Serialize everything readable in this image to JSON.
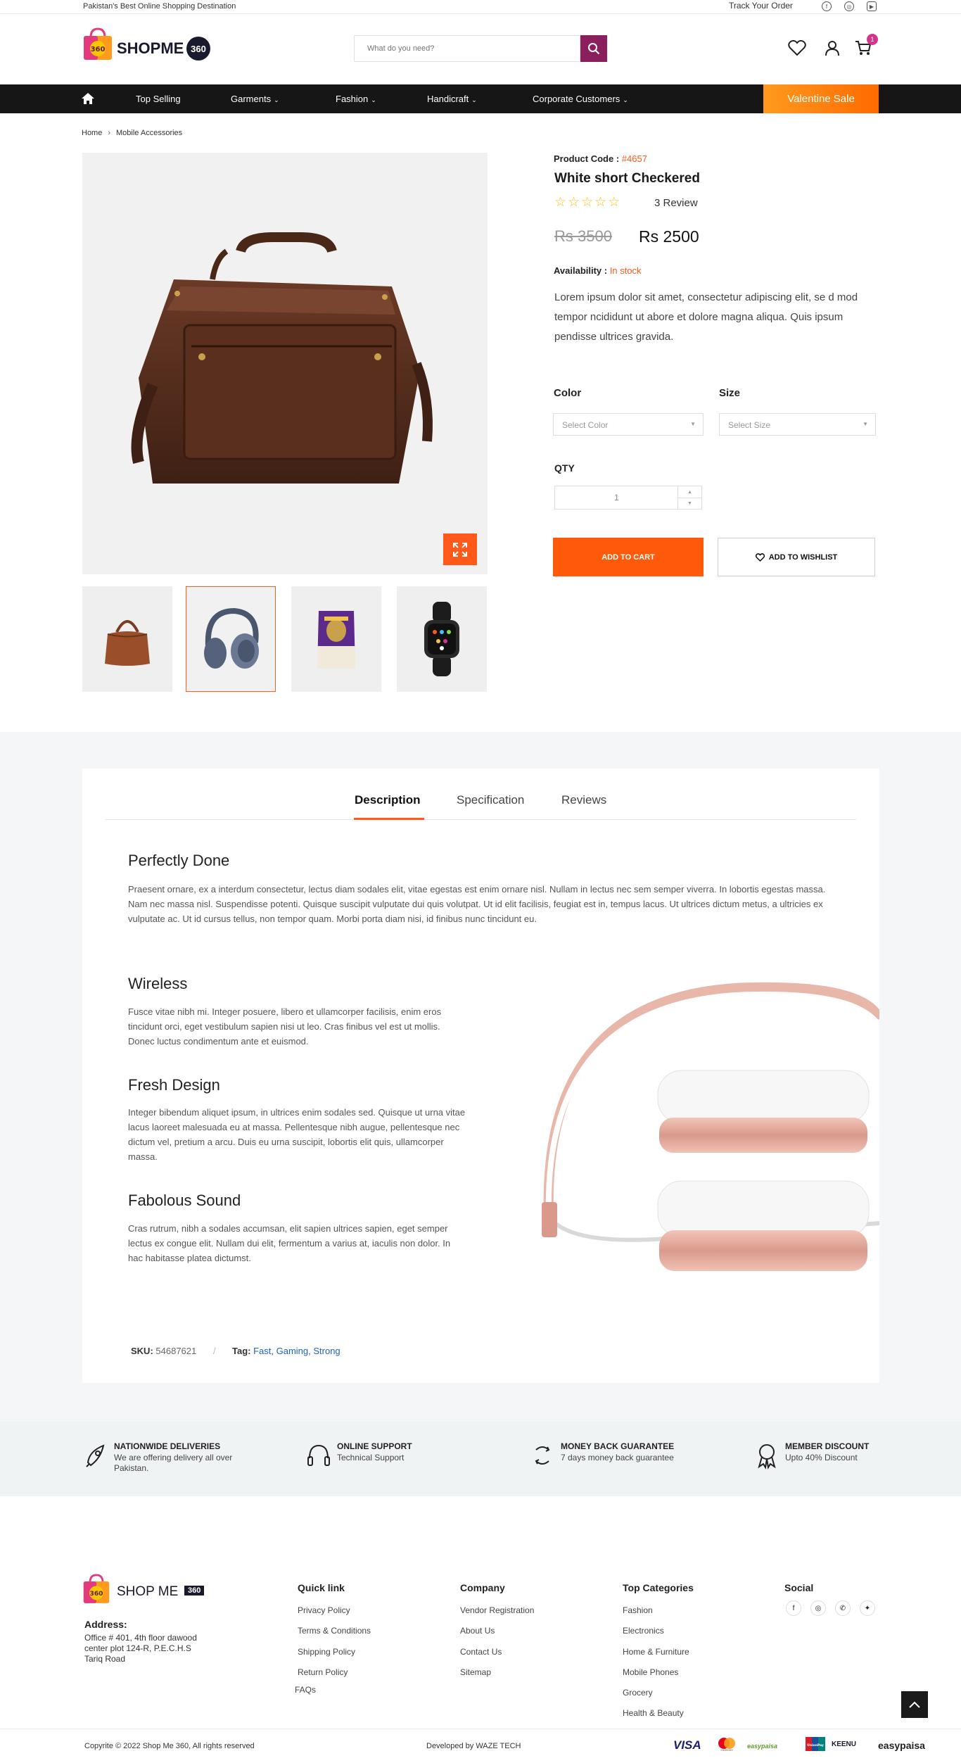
{
  "topbar": {
    "tagline": "Pakistan's Best Online Shopping Destination",
    "track_order": "Track Your Order",
    "social_icons": [
      "facebook-icon",
      "instagram-icon",
      "youtube-icon"
    ]
  },
  "header": {
    "logo_text": "SHOPME",
    "logo_badge": "360",
    "logo_bag_badge": "360",
    "search_placeholder": "What do you need?",
    "cart_count": "1",
    "brand_color": "#8b1e5c"
  },
  "nav": {
    "items": [
      {
        "label": "Top Selling"
      },
      {
        "label": "Garments"
      },
      {
        "label": "Fashion"
      },
      {
        "label": "Handicraft"
      },
      {
        "label": "Corporate Customers"
      }
    ],
    "sale_label": "Valentine Sale"
  },
  "breadcrumb": {
    "items": [
      "Home",
      "Mobile Accessories"
    ]
  },
  "product": {
    "code_label": "Product Code :",
    "code": "#4657",
    "title": "White short Checkered",
    "rating_stars": 0,
    "review_label": "3 Review",
    "old_price": "Rs 3500",
    "new_price": "Rs 2500",
    "availability_label": "Availability :",
    "availability": "In stock",
    "description": "Lorem ipsum dolor sit amet, consectetur adipiscing elit, se d mod tempor ncididunt ut abore et dolore magna aliqua. Quis ipsum pendisse ultrices gravida.",
    "color_label": "Color",
    "color_placeholder": "Select Color",
    "size_label": "Size",
    "size_placeholder": "Select Size",
    "qty_label": "QTY",
    "qty_value": "1",
    "add_to_cart": "ADD TO CART",
    "add_to_wishlist": "ADD TO WISHLIST",
    "accent_color": "#ff5a1a",
    "thumbnails": [
      "handbag",
      "headphones",
      "rice-pack",
      "smartwatch"
    ]
  },
  "tabs": {
    "items": [
      "Description",
      "Specification",
      "Reviews"
    ],
    "active": "Description"
  },
  "description": {
    "perfectly_title": "Perfectly Done",
    "perfectly_text": "Praesent ornare, ex a interdum consectetur, lectus diam sodales elit, vitae egestas est enim ornare nisl. Nullam in lectus nec sem semper viverra. In lobortis egestas massa. Nam nec massa nisl. Suspendisse potenti. Quisque suscipit vulputate dui quis volutpat. Ut id elit facilisis, feugiat est in, tempus lacus. Ut ultrices dictum metus, a ultricies ex vulputate ac. Ut id cursus tellus, non tempor quam. Morbi porta diam nisi, id finibus nunc tincidunt eu.",
    "wireless_title": "Wireless",
    "wireless_text": "Fusce vitae nibh mi. Integer posuere, libero et ullamcorper facilisis, enim eros tincidunt orci, eget vestibulum sapien nisi ut leo. Cras finibus vel est ut mollis. Donec luctus condimentum ante et euismod.",
    "fresh_title": "Fresh Design",
    "fresh_text": "Integer bibendum aliquet ipsum, in ultrices enim sodales sed. Quisque ut urna vitae lacus laoreet malesuada eu at massa. Pellentesque nibh augue, pellentesque nec dictum vel, pretium a arcu. Duis eu urna suscipit, lobortis elit quis, ullamcorper massa.",
    "sound_title": "Fabolous Sound",
    "sound_text": "Cras rutrum, nibh a sodales accumsan, elit sapien ultrices sapien, eget semper lectus ex congue elit. Nullam dui elit, fermentum a varius at, iaculis non dolor. In hac habitasse platea dictumst.",
    "sku_label": "SKU:",
    "sku": "54687621",
    "sku_sep": "/",
    "tag_label": "Tag:",
    "tags": "Fast, Gaming, Strong"
  },
  "features": [
    {
      "title": "NATIONWIDE DELIVERIES",
      "subtitle": "We are offering delivery all over Pakistan.",
      "icon": "rocket-icon"
    },
    {
      "title": "ONLINE SUPPORT",
      "subtitle": "Technical Support",
      "icon": "headset-icon"
    },
    {
      "title": "MONEY BACK GUARANTEE",
      "subtitle": "7 days money back guarantee",
      "icon": "refresh-icon"
    },
    {
      "title": "MEMBER DISCOUNT",
      "subtitle": "Upto 40% Discount",
      "icon": "award-icon"
    }
  ],
  "footer": {
    "logo_text": "SHOP ME",
    "logo_badge": "360",
    "logo_bag_badge": "360",
    "address_label": "Address:",
    "address": "Office # 401, 4th floor dawood center plot 124-R, P.E.C.H.S Tariq Road",
    "quick_link": {
      "title": "Quick link",
      "links": [
        "Privacy Policy",
        "Terms & Conditions",
        "Shipping Policy",
        "Return Policy",
        "FAQs"
      ]
    },
    "company": {
      "title": "Company",
      "links": [
        "Vendor Registration",
        "About Us",
        "Contact Us",
        "Sitemap"
      ]
    },
    "top_categories": {
      "title": "Top Categories",
      "links": [
        "Fashion",
        "Electronics",
        "Home & Furniture",
        "Mobile Phones",
        "Grocery",
        "Health & Beauty"
      ]
    },
    "social": {
      "title": "Social",
      "icons": [
        "facebook-icon",
        "instagram-icon",
        "whatsapp-icon",
        "twitter-icon"
      ]
    },
    "copyright": "Copyrite © 2022 Shop Me 360, All rights reserved",
    "developed": "Developed by WAZE TECH",
    "payments": [
      "VISA",
      "mastercard",
      "easypaisa",
      "UnionPay",
      "KEENU",
      "easypaisa"
    ]
  }
}
